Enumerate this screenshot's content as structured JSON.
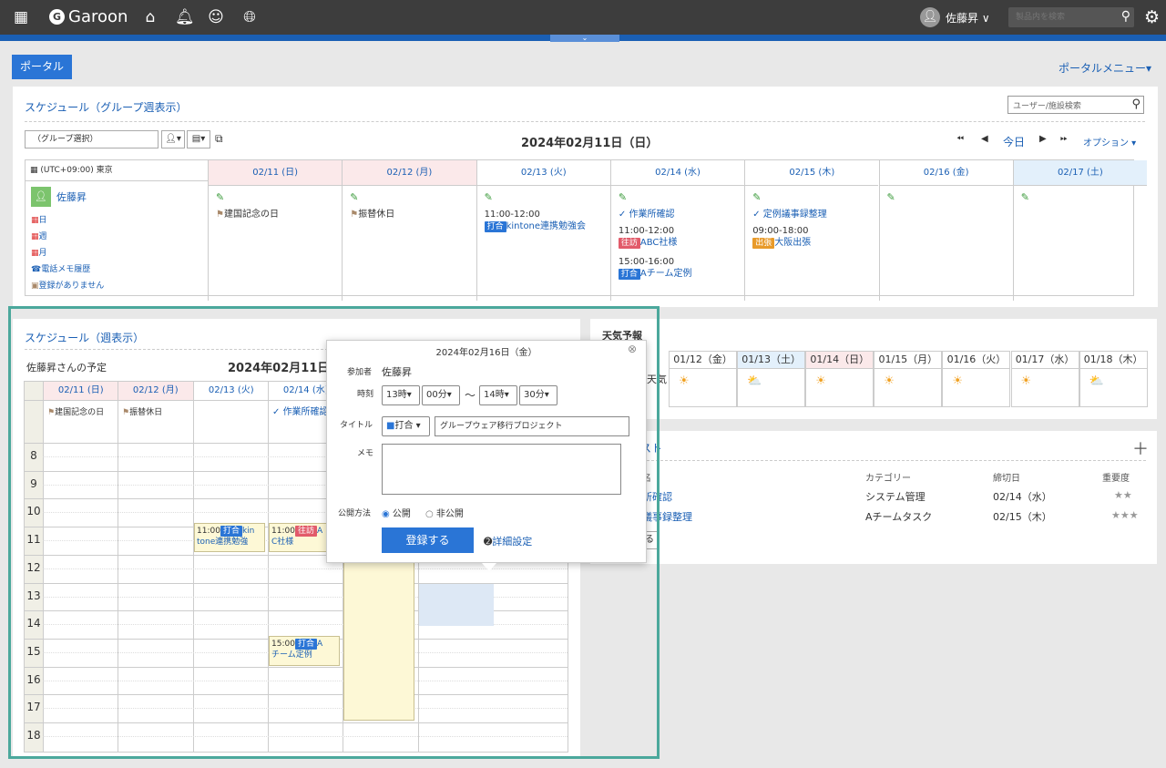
{
  "header": {
    "logo": "Garoon",
    "user_name": "佐藤昇 ∨",
    "search_placeholder": "製品内を検索"
  },
  "portal": {
    "tab": "ポータル",
    "menu": "ポータルメニュー▾"
  },
  "group_week": {
    "title": "スケジュール（グループ週表示）",
    "user_search_placeholder": "ユーザー/施設検索",
    "group_select": "（グループ選択）",
    "date_title": "2024年02月11日（日）",
    "today": "今日",
    "option": "オプション ▾",
    "timezone": "(UTC+09:00) 東京",
    "user": "佐藤昇",
    "links": [
      "日",
      "週",
      "月",
      "電話メモ履歴",
      "登録がありません"
    ],
    "days": [
      {
        "label": "02/11 (日)",
        "bg": "#fbe9ea"
      },
      {
        "label": "02/12 (月)",
        "bg": "#fbe9ea"
      },
      {
        "label": "02/13 (火)",
        "bg": "#ffffff"
      },
      {
        "label": "02/14 (水)",
        "bg": "#ffffff"
      },
      {
        "label": "02/15 (木)",
        "bg": "#ffffff"
      },
      {
        "label": "02/16 (金)",
        "bg": "#ffffff"
      },
      {
        "label": "02/17 (土)",
        "bg": "#e3f0fb"
      }
    ],
    "holiday1": "建国記念の日",
    "holiday2": "振替休日",
    "d13_time": "11:00-12:00",
    "d13_tag": "打合",
    "d13_title": "kintone連携勉強会",
    "d14_todo": "作業所確認",
    "d14_time1": "11:00-12:00",
    "d14_tag1": "往訪",
    "d14_title1": "ABC社様",
    "d14_time2": "15:00-16:00",
    "d14_tag2": "打合",
    "d14_title2": "Aチーム定例",
    "d15_todo": "定例議事録整理",
    "d15_time": "09:00-18:00",
    "d15_tag": "出張",
    "d15_title": "大阪出張"
  },
  "week": {
    "title": "スケジュール（週表示）",
    "owner": "佐藤昇さんの予定",
    "date_title": "2024年02月11日",
    "days": [
      "02/11 (日)",
      "02/12 (月)",
      "02/13 (火)",
      "02/14 (水)"
    ],
    "holiday1": "建国記念の日",
    "holiday2": "振替休日",
    "todo": "作業所確認",
    "hours": [
      "8",
      "9",
      "10",
      "11",
      "12",
      "13",
      "14",
      "15",
      "16",
      "17",
      "18"
    ],
    "ev1_time": "11:00",
    "ev1_tag": "打合",
    "ev1_text": "kin",
    "ev1_text2": "tone連携勉強",
    "ev2_time": "11:00",
    "ev2_tag": "往訪",
    "ev2_text": "A",
    "ev2_text2": "C社様",
    "ev3_time": "15:00",
    "ev3_tag": "打合",
    "ev3_text": "A",
    "ev3_text2": "チーム定例"
  },
  "weather": {
    "title": "天気予報",
    "days": [
      {
        "label": "01/12（金）",
        "icon": "☀",
        "bg": "#ffffff"
      },
      {
        "label": "01/13（土）",
        "icon": "⛅",
        "bg": "#e3f0fb"
      },
      {
        "label": "01/14（日）",
        "icon": "☀",
        "bg": "#fbe9ea"
      },
      {
        "label": "01/15（月）",
        "icon": "☀",
        "bg": "#ffffff"
      },
      {
        "label": "01/16（火）",
        "icon": "☀",
        "bg": "#ffffff"
      },
      {
        "label": "01/17（水）",
        "icon": "☀",
        "bg": "#ffffff"
      },
      {
        "label": "01/18（木）",
        "icon": "⛅",
        "bg": "#ffffff"
      }
    ],
    "partial_label": "天気"
  },
  "todo": {
    "title_partial": "スト",
    "col_name_partial": "名",
    "col_category": "カテゴリー",
    "col_deadline": "締切日",
    "col_priority": "重要度",
    "rows": [
      {
        "name": "所確認",
        "category": "システム管理",
        "deadline": "02/14（水）",
        "priority": "★★"
      },
      {
        "name": "議事録整理",
        "category": "Aチームタスク",
        "deadline": "02/15（木）",
        "priority": "★★★"
      }
    ],
    "btn_partial": "る"
  },
  "popup": {
    "date": "2024年02月16日（金）",
    "attendee_label": "参加者",
    "attendee": "佐藤昇",
    "time_label": "時刻",
    "start_hour": "13時",
    "start_min": "00分",
    "tilde": "〜",
    "end_hour": "14時",
    "end_min": "30分",
    "title_label": "タイトル",
    "menu": "打合",
    "title_value": "グループウェア移行プロジェクト",
    "memo_label": "メモ",
    "visibility_label": "公開方法",
    "public": "公開",
    "private": "非公開",
    "submit": "登録する",
    "detail": "詳細設定"
  }
}
